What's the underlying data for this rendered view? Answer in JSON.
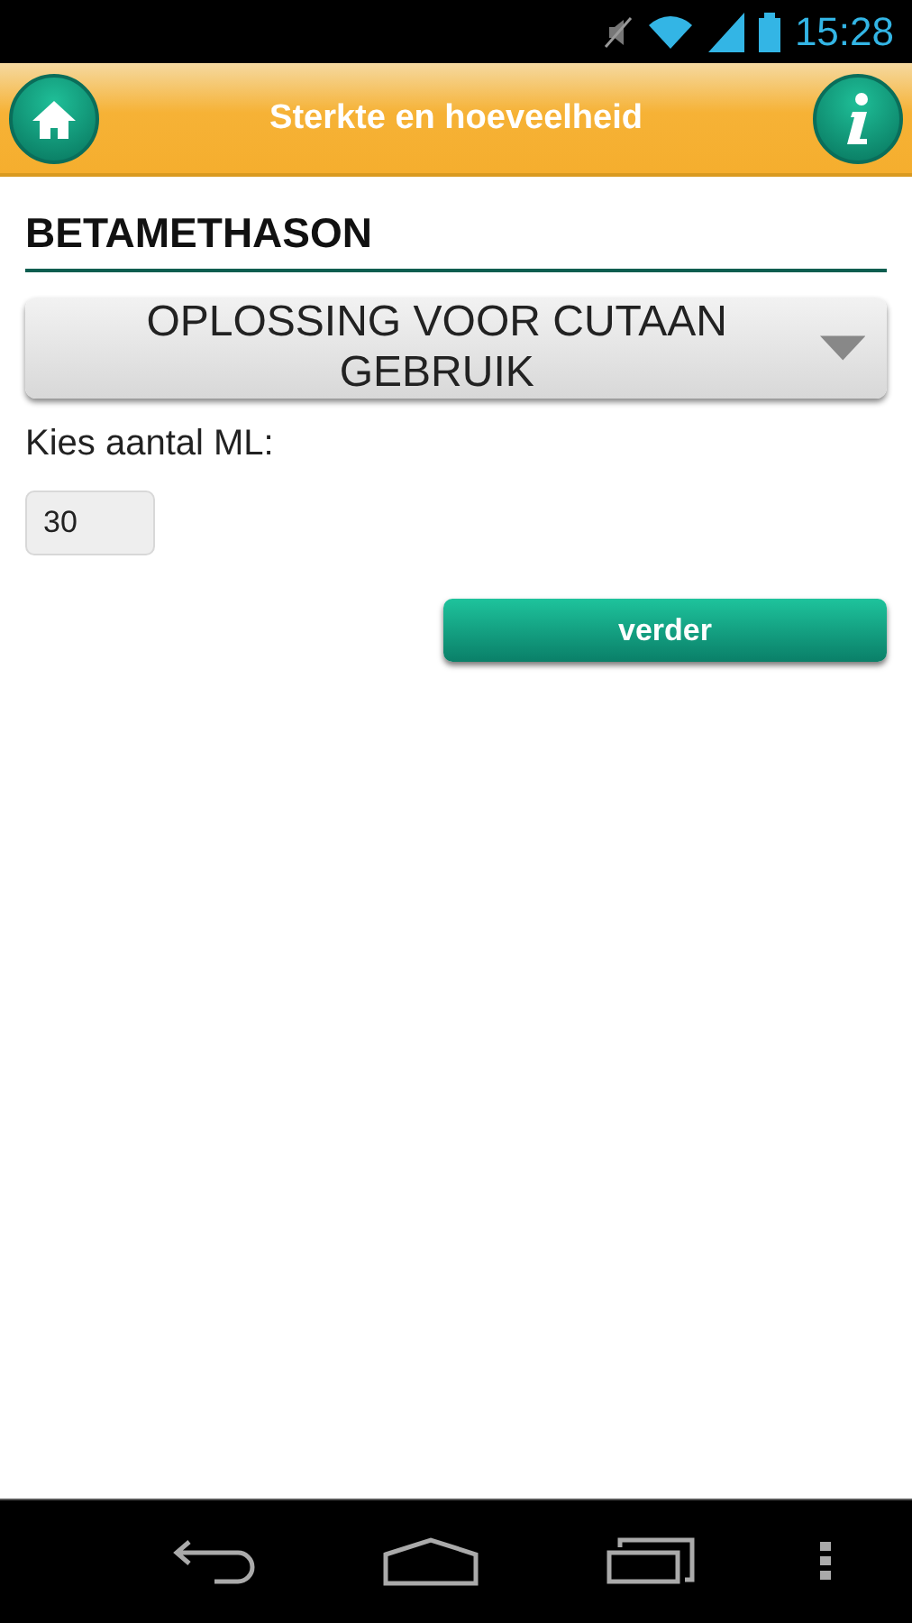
{
  "status_bar": {
    "time": "15:28"
  },
  "header": {
    "title": "Sterkte en hoeveelheid"
  },
  "drug": {
    "name": "BETAMETHASON"
  },
  "form_select": {
    "value": "OPLOSSING VOOR CUTAAN GEBRUIK"
  },
  "amount": {
    "label": "Kies aantal ML:",
    "value": "30"
  },
  "next_button": {
    "label": "verder"
  }
}
